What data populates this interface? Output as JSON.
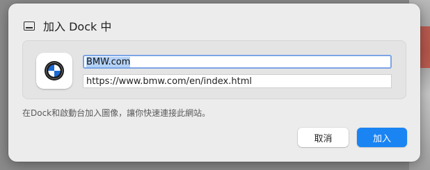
{
  "dialog": {
    "title": "加入 Dock 中",
    "title_icon": "window-icon",
    "app_icon": "bmw-logo-icon",
    "name_value": "BMW.com",
    "url_value": "https://www.bmw.com/en/index.html",
    "hint": "在Dock和啟動台加入圖像，讓你快速連接此網站。",
    "cancel_label": "取消",
    "add_label": "加入",
    "accent_color": "#1a84f3"
  }
}
